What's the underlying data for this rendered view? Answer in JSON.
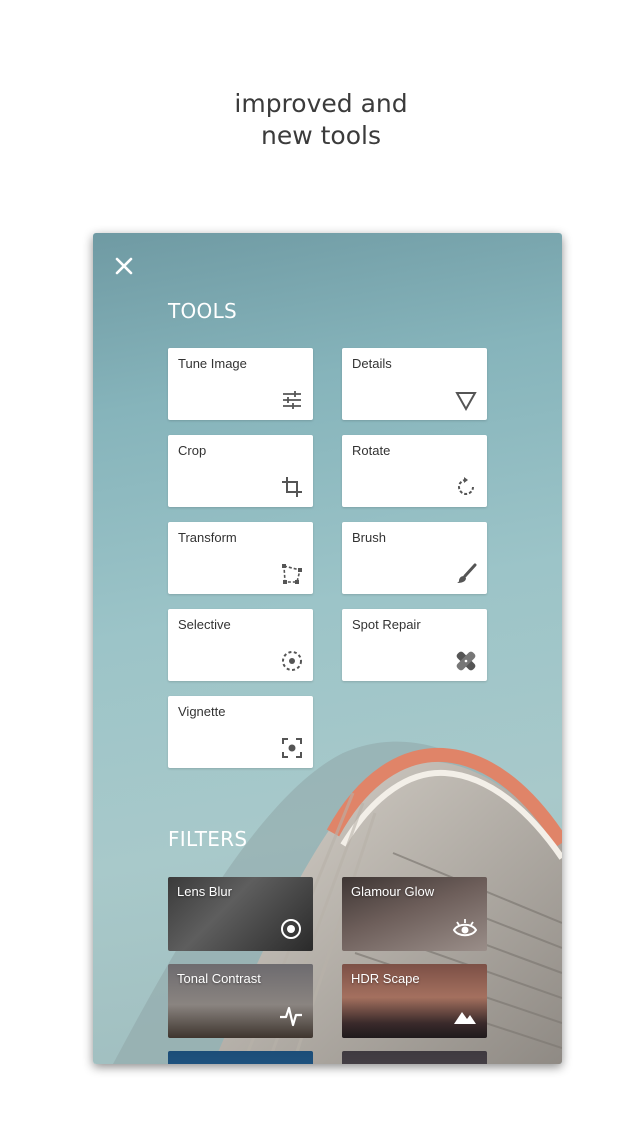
{
  "headline": {
    "line1": "improved and",
    "line2": "new tools"
  },
  "tools": {
    "section_title": "TOOLS",
    "items": [
      {
        "label": "Tune Image",
        "icon": "sliders-icon"
      },
      {
        "label": "Details",
        "icon": "triangle-down-icon"
      },
      {
        "label": "Crop",
        "icon": "crop-icon"
      },
      {
        "label": "Rotate",
        "icon": "rotate-icon"
      },
      {
        "label": "Transform",
        "icon": "perspective-icon"
      },
      {
        "label": "Brush",
        "icon": "brush-icon"
      },
      {
        "label": "Selective",
        "icon": "target-dashed-icon"
      },
      {
        "label": "Spot Repair",
        "icon": "bandage-icon"
      },
      {
        "label": "Vignette",
        "icon": "vignette-icon"
      }
    ]
  },
  "filters": {
    "section_title": "FILTERS",
    "items": [
      {
        "label": "Lens Blur",
        "icon": "target-icon"
      },
      {
        "label": "Glamour Glow",
        "icon": "eye-icon"
      },
      {
        "label": "Tonal Contrast",
        "icon": "pulse-icon"
      },
      {
        "label": "HDR Scape",
        "icon": "mountain-icon"
      }
    ]
  },
  "close_icon": "close-icon",
  "colors": {
    "background_top": "#6f9aa3",
    "background_bottom": "#a8c9ca",
    "card": "#ffffff",
    "text": "#333333"
  }
}
